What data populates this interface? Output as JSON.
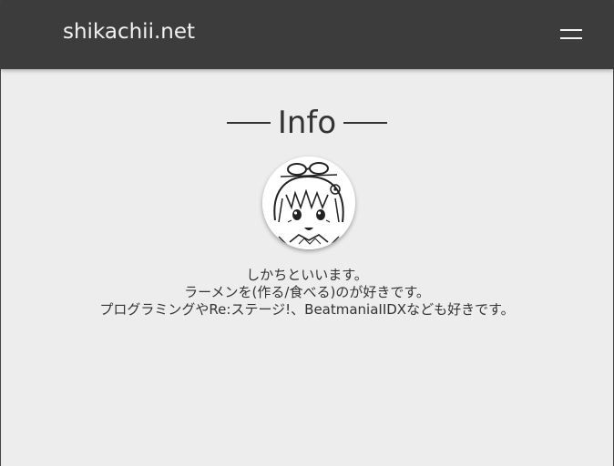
{
  "header": {
    "site_name": "shikachii.net",
    "menu_icon": "hamburger-menu-icon"
  },
  "main": {
    "section_title": "Info",
    "avatar_icon": "avatar-illustration",
    "bio_lines": [
      "しかちといいます。",
      "ラーメンを(作る/食べる)のが好きです。",
      "プログラミングやRe:ステージ!、BeatmaniaIIDXなども好きです。"
    ]
  },
  "colors": {
    "navbar": "#3c3c3c",
    "background": "#ededed",
    "text": "#333333",
    "nav_text": "#f2f2f2"
  }
}
